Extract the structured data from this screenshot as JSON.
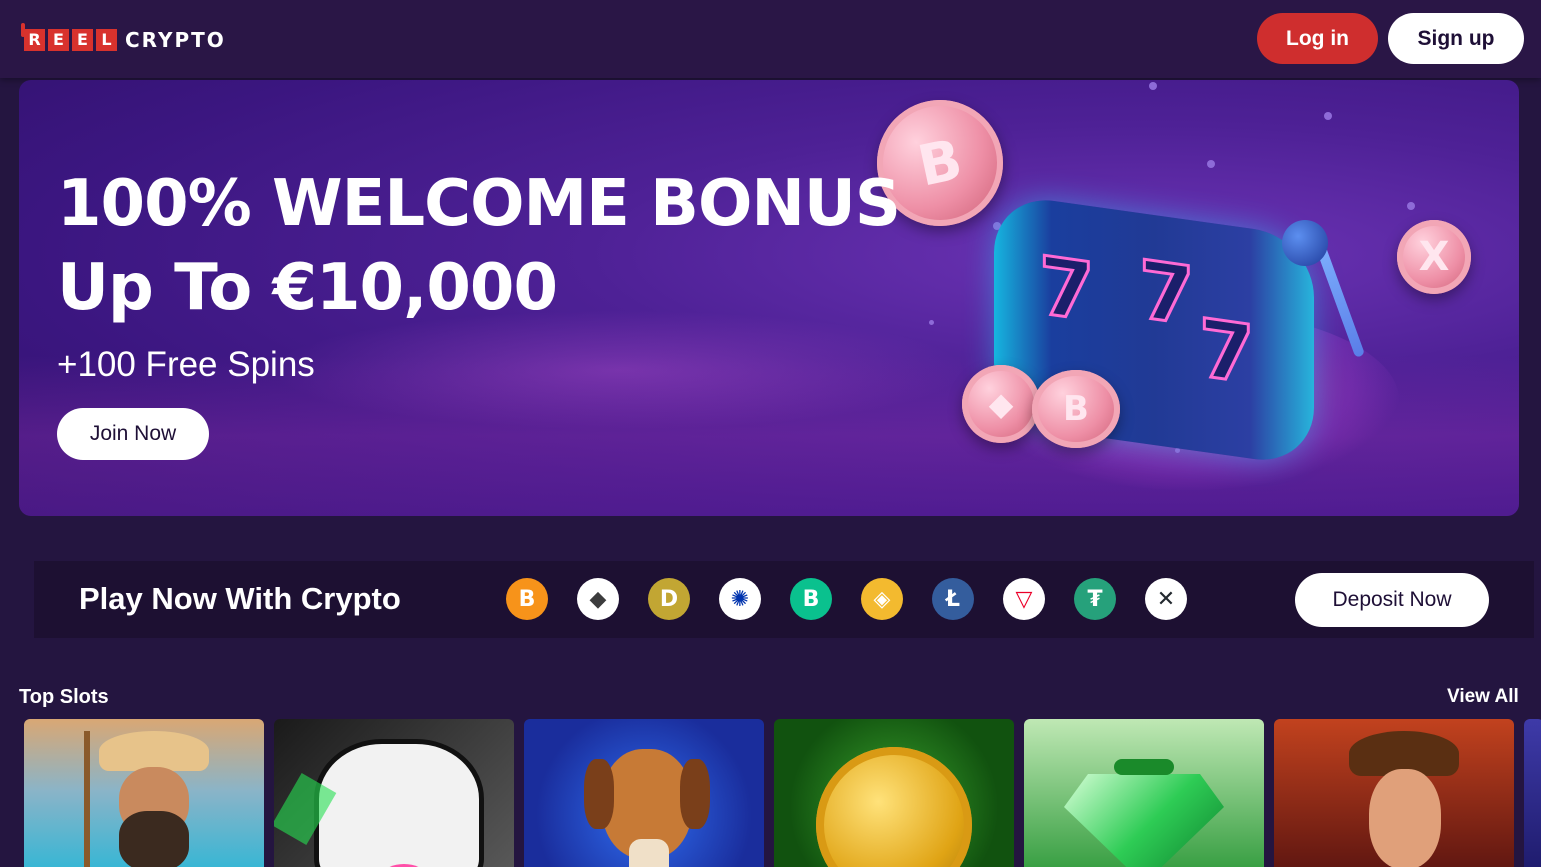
{
  "header": {
    "logo_reel_letters": [
      "R",
      "E",
      "E",
      "L"
    ],
    "logo_crypto": "CRYPTO",
    "login_label": "Log in",
    "signup_label": "Sign up"
  },
  "hero": {
    "title_line1": "100% WELCOME BONUS",
    "title_line2": "Up To €10,000",
    "subtitle": "+100 Free Spins",
    "cta_label": "Join Now",
    "slot_symbols": [
      "7",
      "7",
      "7"
    ],
    "coin_symbols": {
      "big": "B",
      "x": "X",
      "eth": "◆",
      "b2": "B"
    }
  },
  "crypto_bar": {
    "title": "Play Now With Crypto",
    "deposit_label": "Deposit Now",
    "currencies": [
      {
        "name": "bitcoin-icon",
        "glyph": "B",
        "bg": "#f7931a",
        "fg": "#ffffff"
      },
      {
        "name": "ethereum-icon",
        "glyph": "◆",
        "bg": "#ffffff",
        "fg": "#3c3c3d"
      },
      {
        "name": "dogecoin-icon",
        "glyph": "D",
        "bg": "#c2a633",
        "fg": "#ffffff"
      },
      {
        "name": "cardano-icon",
        "glyph": "✺",
        "bg": "#ffffff",
        "fg": "#0033ad"
      },
      {
        "name": "bitcoin-cash-icon",
        "glyph": "B",
        "bg": "#0ac18e",
        "fg": "#ffffff"
      },
      {
        "name": "binance-icon",
        "glyph": "◈",
        "bg": "#f3ba2f",
        "fg": "#ffffff"
      },
      {
        "name": "litecoin-icon",
        "glyph": "Ł",
        "bg": "#345d9d",
        "fg": "#ffffff"
      },
      {
        "name": "tron-icon",
        "glyph": "▽",
        "bg": "#ffffff",
        "fg": "#eb0029"
      },
      {
        "name": "tether-icon",
        "glyph": "₮",
        "bg": "#26a17b",
        "fg": "#ffffff"
      },
      {
        "name": "xrp-icon",
        "glyph": "✕",
        "bg": "#ffffff",
        "fg": "#23292f"
      }
    ]
  },
  "top_slots": {
    "title": "Top Slots",
    "view_all_label": "View All"
  },
  "colors": {
    "background": "#241540",
    "header": "#2a1646",
    "accent_red": "#cf2e2e"
  }
}
